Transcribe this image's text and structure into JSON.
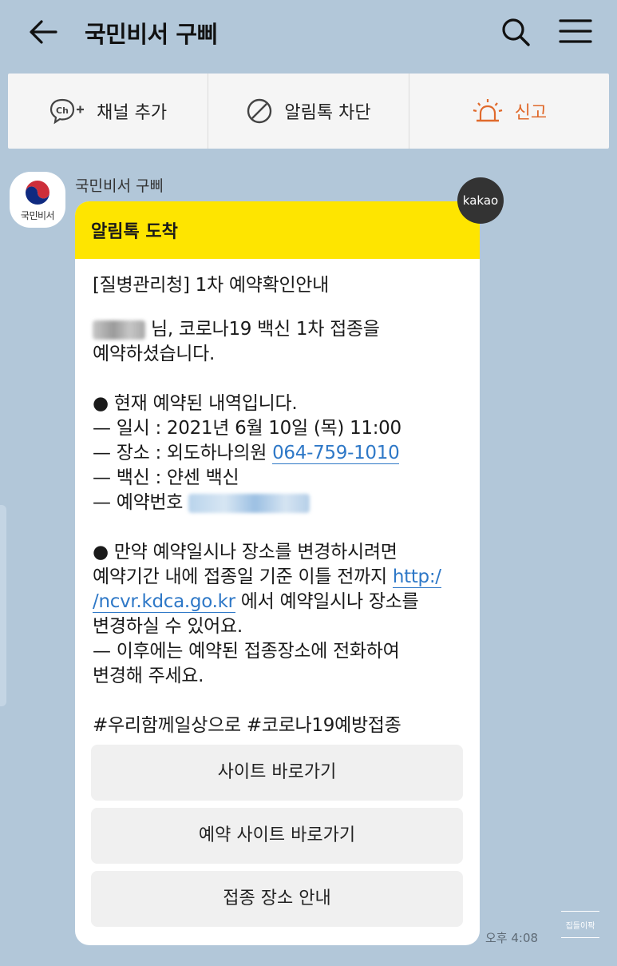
{
  "header": {
    "title": "국민비서 구삐"
  },
  "actions": {
    "add_channel": "채널 추가",
    "block_alimtalk": "알림톡 차단",
    "report": "신고"
  },
  "sender": {
    "name": "국민비서 구삐",
    "avatar_label": "국민비서"
  },
  "message": {
    "header": "알림톡 도착",
    "badge": "kakao",
    "subject": "[질병관리청] 1차 예약확인안내",
    "greeting_suffix": "님, 코로나19 백신 1차 접종을",
    "greeting_line2": "예약하셨습니다.",
    "details_title": "● 현재 예약된 내역입니다.",
    "datetime": "— 일시 : 2021년 6월 10일 (목) 11:00",
    "place_label": "— 장소 : 외도하나의원 ",
    "place_phone": "064-759-1010",
    "vaccine": "— 백신 : 얀센 백신",
    "reservation_label": "— 예약번호 ",
    "change_line1": "● 만약 예약일시나 장소를 변경하시려면",
    "change_line2_prefix": "예약기간 내에 접종일 기준 이틀 전까지 ",
    "change_link_part1": "http:/",
    "change_link_part2": "/ncvr.kdca.go.kr",
    "change_line3_suffix": " 에서 예약일시나 장소를",
    "change_line4": "변경하실 수 있어요.",
    "after_line1": "— 이후에는 예약된 접종장소에 전화하여",
    "after_line2": "변경해 주세요.",
    "hashtags": "#우리함께일상으로 #코로나19예방접종",
    "buttons": [
      "사이트 바로가기",
      "예약 사이트 바로가기",
      "접종 장소 안내"
    ],
    "time": "오후 4:08"
  },
  "watermark": "집들이팍",
  "colors": {
    "background": "#b2c7d9",
    "header_yellow": "#fee500",
    "link_blue": "#2e78c7",
    "report_orange": "#e06a2c"
  },
  "icons": {
    "back": "arrow-left-icon",
    "search": "search-icon",
    "menu": "hamburger-icon",
    "add_channel": "channel-plus-icon",
    "block": "block-icon",
    "report": "siren-icon"
  }
}
